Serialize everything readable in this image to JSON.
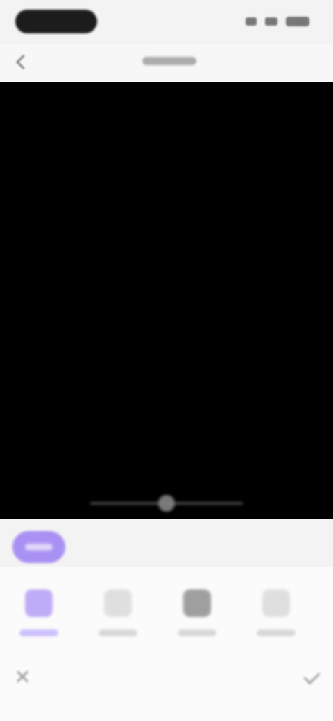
{
  "status_bar": {
    "time": "",
    "icons": [
      "signal-icon",
      "wifi-icon",
      "battery-icon"
    ]
  },
  "toolbar": {
    "back_icon": "back-icon",
    "title": ""
  },
  "canvas": {
    "background": "#000000",
    "scrubber": {
      "icon": "timeline-scrubber"
    }
  },
  "editor": {
    "accent": "#a68cf4",
    "category": {
      "selected_label": ""
    },
    "tools": [
      {
        "label": "",
        "icon": "tool-icon"
      },
      {
        "label": "",
        "icon": "tool-icon"
      },
      {
        "label": "",
        "icon": "tool-icon"
      },
      {
        "label": "",
        "icon": "tool-icon"
      },
      {
        "label": "",
        "icon": "tool-icon"
      }
    ],
    "actions": {
      "cancel_icon": "close-icon",
      "apply_icon": "check-icon"
    }
  }
}
